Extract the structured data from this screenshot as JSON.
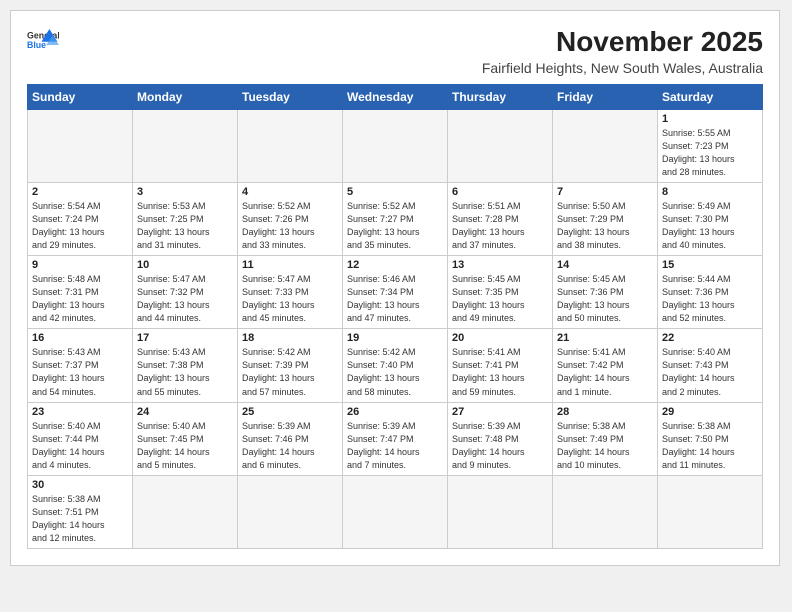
{
  "header": {
    "logo_line1": "General",
    "logo_line2": "Blue",
    "month_title": "November 2025",
    "location": "Fairfield Heights, New South Wales, Australia"
  },
  "weekdays": [
    "Sunday",
    "Monday",
    "Tuesday",
    "Wednesday",
    "Thursday",
    "Friday",
    "Saturday"
  ],
  "weeks": [
    [
      {
        "day": "",
        "info": ""
      },
      {
        "day": "",
        "info": ""
      },
      {
        "day": "",
        "info": ""
      },
      {
        "day": "",
        "info": ""
      },
      {
        "day": "",
        "info": ""
      },
      {
        "day": "",
        "info": ""
      },
      {
        "day": "1",
        "info": "Sunrise: 5:55 AM\nSunset: 7:23 PM\nDaylight: 13 hours\nand 28 minutes."
      }
    ],
    [
      {
        "day": "2",
        "info": "Sunrise: 5:54 AM\nSunset: 7:24 PM\nDaylight: 13 hours\nand 29 minutes."
      },
      {
        "day": "3",
        "info": "Sunrise: 5:53 AM\nSunset: 7:25 PM\nDaylight: 13 hours\nand 31 minutes."
      },
      {
        "day": "4",
        "info": "Sunrise: 5:52 AM\nSunset: 7:26 PM\nDaylight: 13 hours\nand 33 minutes."
      },
      {
        "day": "5",
        "info": "Sunrise: 5:52 AM\nSunset: 7:27 PM\nDaylight: 13 hours\nand 35 minutes."
      },
      {
        "day": "6",
        "info": "Sunrise: 5:51 AM\nSunset: 7:28 PM\nDaylight: 13 hours\nand 37 minutes."
      },
      {
        "day": "7",
        "info": "Sunrise: 5:50 AM\nSunset: 7:29 PM\nDaylight: 13 hours\nand 38 minutes."
      },
      {
        "day": "8",
        "info": "Sunrise: 5:49 AM\nSunset: 7:30 PM\nDaylight: 13 hours\nand 40 minutes."
      }
    ],
    [
      {
        "day": "9",
        "info": "Sunrise: 5:48 AM\nSunset: 7:31 PM\nDaylight: 13 hours\nand 42 minutes."
      },
      {
        "day": "10",
        "info": "Sunrise: 5:47 AM\nSunset: 7:32 PM\nDaylight: 13 hours\nand 44 minutes."
      },
      {
        "day": "11",
        "info": "Sunrise: 5:47 AM\nSunset: 7:33 PM\nDaylight: 13 hours\nand 45 minutes."
      },
      {
        "day": "12",
        "info": "Sunrise: 5:46 AM\nSunset: 7:34 PM\nDaylight: 13 hours\nand 47 minutes."
      },
      {
        "day": "13",
        "info": "Sunrise: 5:45 AM\nSunset: 7:35 PM\nDaylight: 13 hours\nand 49 minutes."
      },
      {
        "day": "14",
        "info": "Sunrise: 5:45 AM\nSunset: 7:36 PM\nDaylight: 13 hours\nand 50 minutes."
      },
      {
        "day": "15",
        "info": "Sunrise: 5:44 AM\nSunset: 7:36 PM\nDaylight: 13 hours\nand 52 minutes."
      }
    ],
    [
      {
        "day": "16",
        "info": "Sunrise: 5:43 AM\nSunset: 7:37 PM\nDaylight: 13 hours\nand 54 minutes."
      },
      {
        "day": "17",
        "info": "Sunrise: 5:43 AM\nSunset: 7:38 PM\nDaylight: 13 hours\nand 55 minutes."
      },
      {
        "day": "18",
        "info": "Sunrise: 5:42 AM\nSunset: 7:39 PM\nDaylight: 13 hours\nand 57 minutes."
      },
      {
        "day": "19",
        "info": "Sunrise: 5:42 AM\nSunset: 7:40 PM\nDaylight: 13 hours\nand 58 minutes."
      },
      {
        "day": "20",
        "info": "Sunrise: 5:41 AM\nSunset: 7:41 PM\nDaylight: 13 hours\nand 59 minutes."
      },
      {
        "day": "21",
        "info": "Sunrise: 5:41 AM\nSunset: 7:42 PM\nDaylight: 14 hours\nand 1 minute."
      },
      {
        "day": "22",
        "info": "Sunrise: 5:40 AM\nSunset: 7:43 PM\nDaylight: 14 hours\nand 2 minutes."
      }
    ],
    [
      {
        "day": "23",
        "info": "Sunrise: 5:40 AM\nSunset: 7:44 PM\nDaylight: 14 hours\nand 4 minutes."
      },
      {
        "day": "24",
        "info": "Sunrise: 5:40 AM\nSunset: 7:45 PM\nDaylight: 14 hours\nand 5 minutes."
      },
      {
        "day": "25",
        "info": "Sunrise: 5:39 AM\nSunset: 7:46 PM\nDaylight: 14 hours\nand 6 minutes."
      },
      {
        "day": "26",
        "info": "Sunrise: 5:39 AM\nSunset: 7:47 PM\nDaylight: 14 hours\nand 7 minutes."
      },
      {
        "day": "27",
        "info": "Sunrise: 5:39 AM\nSunset: 7:48 PM\nDaylight: 14 hours\nand 9 minutes."
      },
      {
        "day": "28",
        "info": "Sunrise: 5:38 AM\nSunset: 7:49 PM\nDaylight: 14 hours\nand 10 minutes."
      },
      {
        "day": "29",
        "info": "Sunrise: 5:38 AM\nSunset: 7:50 PM\nDaylight: 14 hours\nand 11 minutes."
      }
    ],
    [
      {
        "day": "30",
        "info": "Sunrise: 5:38 AM\nSunset: 7:51 PM\nDaylight: 14 hours\nand 12 minutes."
      },
      {
        "day": "",
        "info": ""
      },
      {
        "day": "",
        "info": ""
      },
      {
        "day": "",
        "info": ""
      },
      {
        "day": "",
        "info": ""
      },
      {
        "day": "",
        "info": ""
      },
      {
        "day": "",
        "info": ""
      }
    ]
  ]
}
